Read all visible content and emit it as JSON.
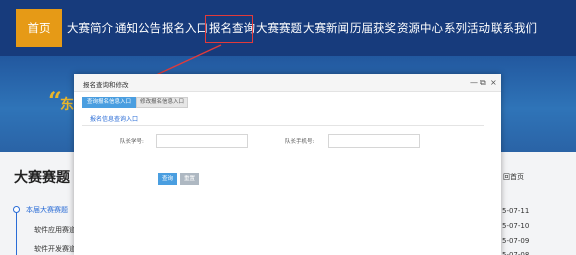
{
  "nav": {
    "items": [
      {
        "label": "首页",
        "active": true
      },
      {
        "label": "大赛简介"
      },
      {
        "label": "通知公告"
      },
      {
        "label": "报名入口"
      },
      {
        "label": "报名查询",
        "highlighted": true
      },
      {
        "label": "大赛赛题"
      },
      {
        "label": "大赛新闻"
      },
      {
        "label": "历届获奖"
      },
      {
        "label": "资源中心"
      },
      {
        "label": "系列活动"
      },
      {
        "label": "联系我们"
      }
    ],
    "active_color": "#e69a16",
    "bar_color": "#173b7c",
    "highlight_color": "#e23a3a"
  },
  "banner": {
    "quote_mark": "“",
    "partial_text": "东"
  },
  "page": {
    "title": "大赛赛题",
    "sidebar": [
      "本届大赛赛题",
      "软件应用赛道",
      "软件开发赛道"
    ],
    "right_link": "回首页",
    "dates": [
      "5-07-11",
      "5-07-10",
      "5-07-09",
      "5-07-08"
    ]
  },
  "dialog": {
    "title": "报名查询和修改",
    "controls": {
      "minimize": "—",
      "maximize": "⧉",
      "close": "×"
    },
    "tabs": [
      {
        "label": "查询报名信息入口",
        "active": true
      },
      {
        "label": "修改报名信息入口",
        "active": false
      }
    ],
    "subtab": "报名信息查询入口",
    "fields": [
      {
        "label": "队长学号:",
        "value": "",
        "placeholder": ""
      },
      {
        "label": "队长手机号:",
        "value": "",
        "placeholder": ""
      }
    ],
    "buttons": {
      "query": "查询",
      "reset": "重置"
    },
    "accent": "#4a9ee0"
  }
}
